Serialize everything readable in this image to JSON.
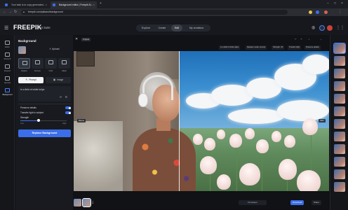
{
  "browser": {
    "tabs": [
      {
        "label": "Your task is to copy generated..."
      },
      {
        "label": "Background editor | Freepik AI..."
      }
    ],
    "url": "freepik.com/pikaso/background"
  },
  "app": {
    "logo": "FREEPIK",
    "suite": "AI Suite",
    "modes": [
      "Explore",
      "Create",
      "Edit",
      "My creations"
    ],
    "active_mode": "Edit"
  },
  "rail": {
    "items": [
      {
        "label": "Editor"
      },
      {
        "label": "Retouch"
      },
      {
        "label": "Expand"
      },
      {
        "label": "Upscale"
      },
      {
        "label": "Background"
      }
    ]
  },
  "panel": {
    "title": "Background",
    "upload_label": "Upload",
    "options": [
      "Replace",
      "Remove",
      "Color",
      "Adjust"
    ],
    "segment": {
      "left": "Prompt",
      "right": "Image"
    },
    "prompt_text": "In a field of white tulips",
    "toggles": [
      {
        "label": "Preserve details",
        "on": true
      },
      {
        "label": "Transfer light to subject",
        "on": true
      }
    ],
    "strength_label": "Strength",
    "strength_min": "Low",
    "strength_max": "High",
    "strength_value": 0.4,
    "cta": "Replace Background"
  },
  "canvas": {
    "original_tag": "Original",
    "chips": [
      "In a field of white tulips",
      "Replace mode: prompt",
      "Strength: 40",
      "Transfer light",
      "Preserve details"
    ],
    "before_label": "Before",
    "after_label": "After",
    "zoom_label": "Fit screen",
    "buttons": {
      "download": "Download",
      "share": "Share"
    }
  },
  "colors": {
    "accent": "#3b6ee8",
    "bg": "#111317"
  }
}
